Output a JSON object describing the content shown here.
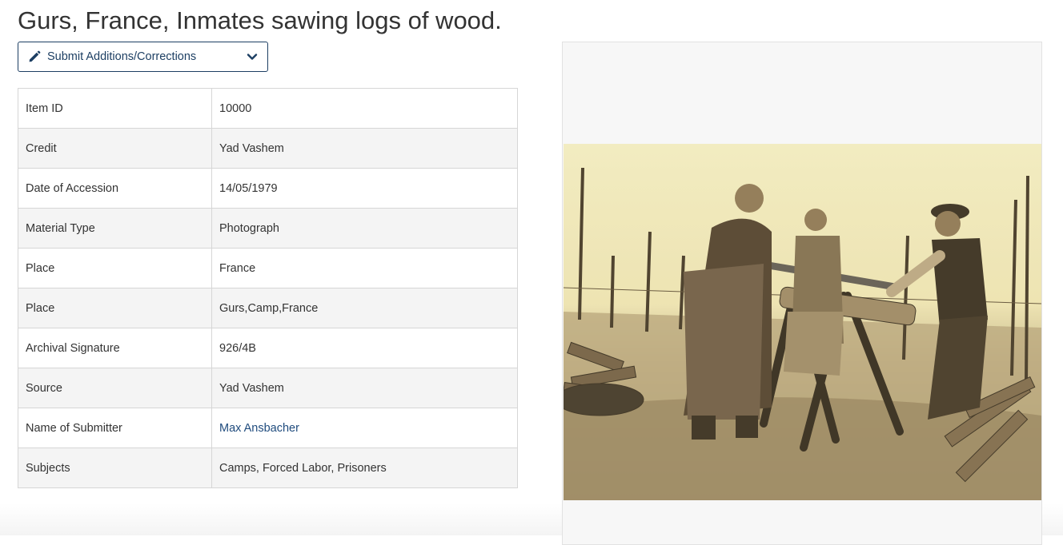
{
  "page": {
    "title": "Gurs, France, Inmates sawing logs of wood."
  },
  "submit_button": {
    "label": "Submit Additions/Corrections",
    "icon": "pencil-icon",
    "dropdown_icon": "chevron-down-icon"
  },
  "details": [
    {
      "key": "Item ID",
      "value": "10000"
    },
    {
      "key": "Credit",
      "value": "Yad Vashem"
    },
    {
      "key": "Date of Accession",
      "value": "14/05/1979"
    },
    {
      "key": "Material Type",
      "value": "Photograph"
    },
    {
      "key": "Place",
      "value": "France"
    },
    {
      "key": "Place",
      "value": "Gurs,Camp,France"
    },
    {
      "key": "Archival Signature",
      "value": "926/4B"
    },
    {
      "key": "Source",
      "value": "Yad Vashem"
    },
    {
      "key": "Name of Submitter",
      "value": "Max Ansbacher"
    },
    {
      "key": "Subjects",
      "value": "Camps, Forced Labor, Prisoners"
    }
  ],
  "colors": {
    "link": "#1f4b7d",
    "button_border": "#1d3f63",
    "row_alt": "#f4f4f4",
    "photo_sepia": "#f2ecc0"
  }
}
